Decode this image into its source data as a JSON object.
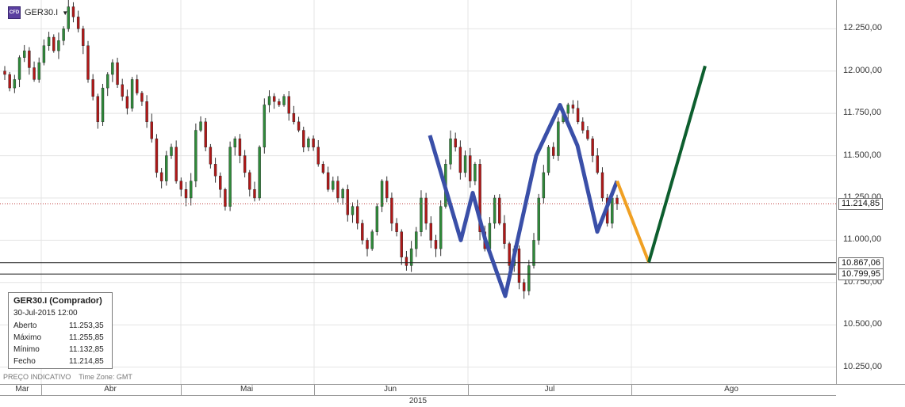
{
  "symbol": {
    "name": "GER30.I",
    "icon": "cfd-icon",
    "icon_text": "CFD"
  },
  "price_axis": {
    "ticks": [
      "12.250,00",
      "12.000,00",
      "11.750,00",
      "11.500,00",
      "11.250,00",
      "11.000,00",
      "10.750,00",
      "10.500,00",
      "10.250,00"
    ],
    "tick_values": [
      12250,
      12000,
      11750,
      11500,
      11250,
      11000,
      10750,
      10500,
      10250
    ],
    "current_price": "11.214,85",
    "current_price_value": 11214.85,
    "support_1": "10.867,06",
    "support_1_value": 10867.06,
    "support_2": "10.799,95",
    "support_2_value": 10799.95
  },
  "time_axis": {
    "months": [
      "Mar",
      "Abr",
      "Mai",
      "Jun",
      "Jul",
      "Ago"
    ],
    "year": "2015"
  },
  "info_box": {
    "title": "GER30.I (Comprador)",
    "datetime": "30-Jul-2015 12:00",
    "rows": [
      {
        "label": "Aberto",
        "value": "11.253,35"
      },
      {
        "label": "Máximo",
        "value": "11.255,85"
      },
      {
        "label": "Mínimo",
        "value": "11.132,85"
      },
      {
        "label": "Fecho",
        "value": "11.214,85"
      }
    ]
  },
  "footer": {
    "indicative": "PREÇO INDICATIVO",
    "timezone": "Time Zone: GMT"
  },
  "colors": {
    "wave": "#3a4fa8",
    "projection_down": "#f0a023",
    "projection_up": "#0d5e2e",
    "candle_up": "#2f8a3a",
    "candle_down": "#b01818",
    "grid": "#e4e4e4",
    "price_line": "#c04040"
  },
  "chart_data": {
    "type": "candlestick",
    "close_series": [
      11980,
      11900,
      11950,
      12080,
      12120,
      12020,
      11950,
      12050,
      12150,
      12200,
      12120,
      12180,
      12250,
      12380,
      12320,
      12250,
      12150,
      11950,
      11850,
      11700,
      11900,
      11980,
      12050,
      11920,
      11850,
      11780,
      11950,
      11870,
      11820,
      11700,
      11600,
      11400,
      11350,
      11500,
      11550,
      11350,
      11300,
      11250,
      11350,
      11650,
      11700,
      11550,
      11450,
      11380,
      11300,
      11200,
      11550,
      11600,
      11500,
      11400,
      11300,
      11250,
      11550,
      11800,
      11850,
      11820,
      11800,
      11850,
      11750,
      11700,
      11650,
      11550,
      11600,
      11550,
      11450,
      11400,
      11300,
      11350,
      11250,
      11300,
      11150,
      11200,
      11100,
      11000,
      10950,
      11050,
      11200,
      11350,
      11250,
      11100,
      11050,
      10900,
      10850,
      10950,
      11050,
      11250,
      11100,
      11000,
      10950,
      11200,
      11450,
      11600,
      11550,
      11400,
      11500,
      11350,
      11450,
      11050,
      10950,
      11100,
      11250,
      11100,
      10980,
      10850,
      10950,
      10750,
      10700,
      10850,
      11000,
      11250,
      11400,
      11550,
      11500,
      11700,
      11750,
      11800,
      11780,
      11700,
      11650,
      11600,
      11500,
      11400,
      11250,
      11100,
      11250,
      11214.85
    ],
    "wave_path": [
      11620,
      11360,
      11000,
      11280,
      11000,
      10670,
      11000,
      11500,
      11800,
      11560,
      11050,
      11350
    ],
    "projection_down": [
      11350,
      10870
    ],
    "projection_up": [
      10870,
      12030
    ],
    "x_range": [
      "Mar",
      "Ago"
    ],
    "ylim": [
      10150,
      12420
    ]
  }
}
